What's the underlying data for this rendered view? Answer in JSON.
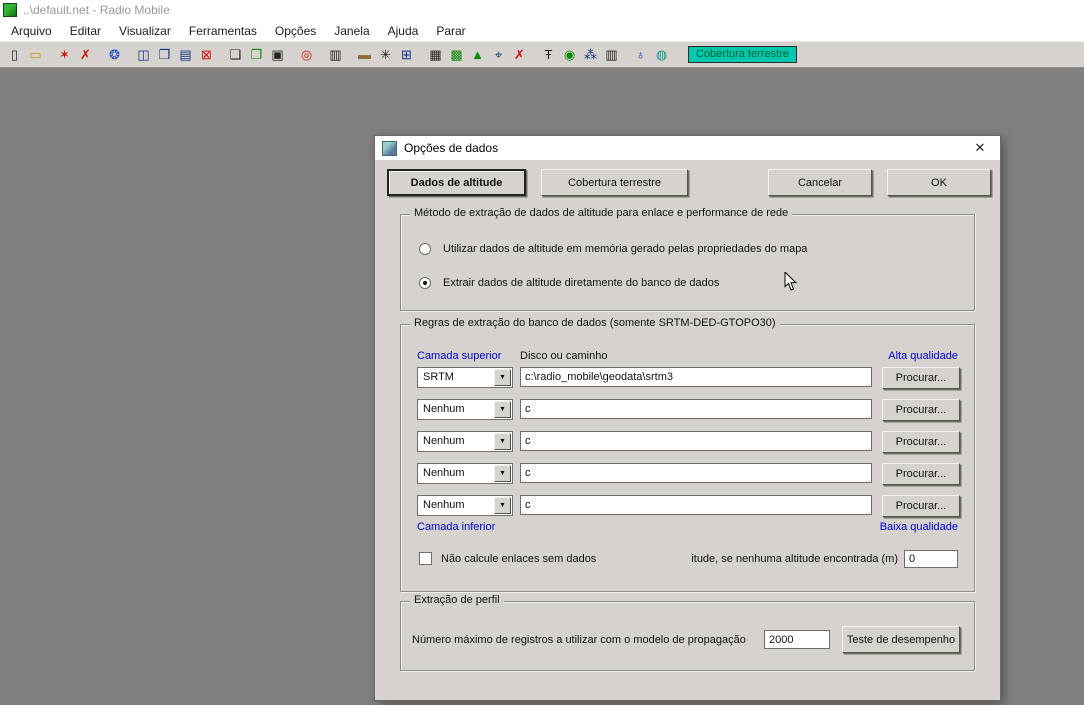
{
  "window": {
    "title": "..\\default.net - Radio Mobile"
  },
  "menu": {
    "items": [
      "Arquivo",
      "Editar",
      "Visualizar",
      "Ferramentas",
      "Opções",
      "Janela",
      "Ajuda",
      "Parar"
    ]
  },
  "toolbar": {
    "status_label": "Cobertura terrestre",
    "icons": [
      {
        "name": "new-network-icon",
        "glyph": "▯"
      },
      {
        "name": "open-network-icon",
        "glyph": "▭"
      },
      {
        "name": "networks-icon",
        "glyph": "✶"
      },
      {
        "name": "delete-unit-icon",
        "glyph": "✗"
      },
      {
        "name": "compass-icon",
        "glyph": "❂"
      },
      {
        "name": "tile-windows-icon",
        "glyph": "◫"
      },
      {
        "name": "new-window-icon",
        "glyph": "❐"
      },
      {
        "name": "save-picture-icon",
        "glyph": "▤"
      },
      {
        "name": "close-window-icon",
        "glyph": "⊠"
      },
      {
        "name": "copy-icon",
        "glyph": "❏"
      },
      {
        "name": "copy-add-icon",
        "glyph": "❐"
      },
      {
        "name": "paste-icon",
        "glyph": "▣"
      },
      {
        "name": "target-icon",
        "glyph": "◎"
      },
      {
        "name": "legend-icon",
        "glyph": "▥"
      },
      {
        "name": "ruler-icon",
        "glyph": "▬"
      },
      {
        "name": "antenna-pattern-icon",
        "glyph": "✳"
      },
      {
        "name": "grid-edit-icon",
        "glyph": "⊞"
      },
      {
        "name": "frame-icon",
        "glyph": "▦"
      },
      {
        "name": "coverage-icon",
        "glyph": "▩"
      },
      {
        "name": "route-icon",
        "glyph": "▲"
      },
      {
        "name": "selection-icon",
        "glyph": "⌖"
      },
      {
        "name": "delete-coverage-icon",
        "glyph": "✗"
      },
      {
        "name": "antenna-icon",
        "glyph": "Ŧ"
      },
      {
        "name": "best-site-icon",
        "glyph": "◉"
      },
      {
        "name": "interference-icon",
        "glyph": "⁂"
      },
      {
        "name": "fence-icon",
        "glyph": "▥"
      },
      {
        "name": "world-map-icon",
        "glyph": "♁"
      },
      {
        "name": "geodata-icon",
        "glyph": "◍"
      }
    ]
  },
  "glyphs": {
    "combo_arrow": "▼",
    "close": "✕"
  },
  "colors": {
    "status_bg": "#00c7ae",
    "accent_blue": "#0000d2"
  },
  "dialog": {
    "title": "Opções de dados",
    "tabs": [
      {
        "label": "Dados de altitude",
        "active": true
      },
      {
        "label": "Cobertura terrestre",
        "active": false
      }
    ],
    "cancel_label": "Cancelar",
    "ok_label": "OK",
    "method_group": {
      "legend": "Método de extração de dados de altitude para enlace e performance de rede",
      "options": [
        {
          "label": "Utilizar dados de altitude em memória gerado pelas propriedades do mapa",
          "selected": false
        },
        {
          "label": "Extrair dados de altitude diretamente do banco de dados",
          "selected": true
        }
      ]
    },
    "rules_group": {
      "legend": "Regras de extração do banco de dados (somente SRTM-DED-GTOPO30)",
      "col_top_layer": "Camada superior",
      "col_path": "Disco ou caminho",
      "col_quality_top": "Alta qualidade",
      "rows": [
        {
          "layer": "SRTM",
          "path": "c:\\radio_mobile\\geodata\\srtm3",
          "browse": "Procurar..."
        },
        {
          "layer": "Nenhum",
          "path": "c",
          "browse": "Procurar..."
        },
        {
          "layer": "Nenhum",
          "path": "c",
          "browse": "Procurar..."
        },
        {
          "layer": "Nenhum",
          "path": "c",
          "browse": "Procurar..."
        },
        {
          "layer": "Nenhum",
          "path": "c",
          "browse": "Procurar..."
        }
      ],
      "bottom_layer_label": "Camada inferior",
      "bottom_quality_label": "Baixa qualidade",
      "checkbox_label": "Não calcule enlaces sem dados",
      "altitude_label": "itude, se nenhuma altitude encontrada (m)",
      "altitude_value": "0"
    },
    "profile_group": {
      "legend": "Extração de perfil",
      "label": "Número máximo de registros a utilizar com o modelo de propagação",
      "value": "2000",
      "test_button": "Teste de desempenho"
    }
  }
}
